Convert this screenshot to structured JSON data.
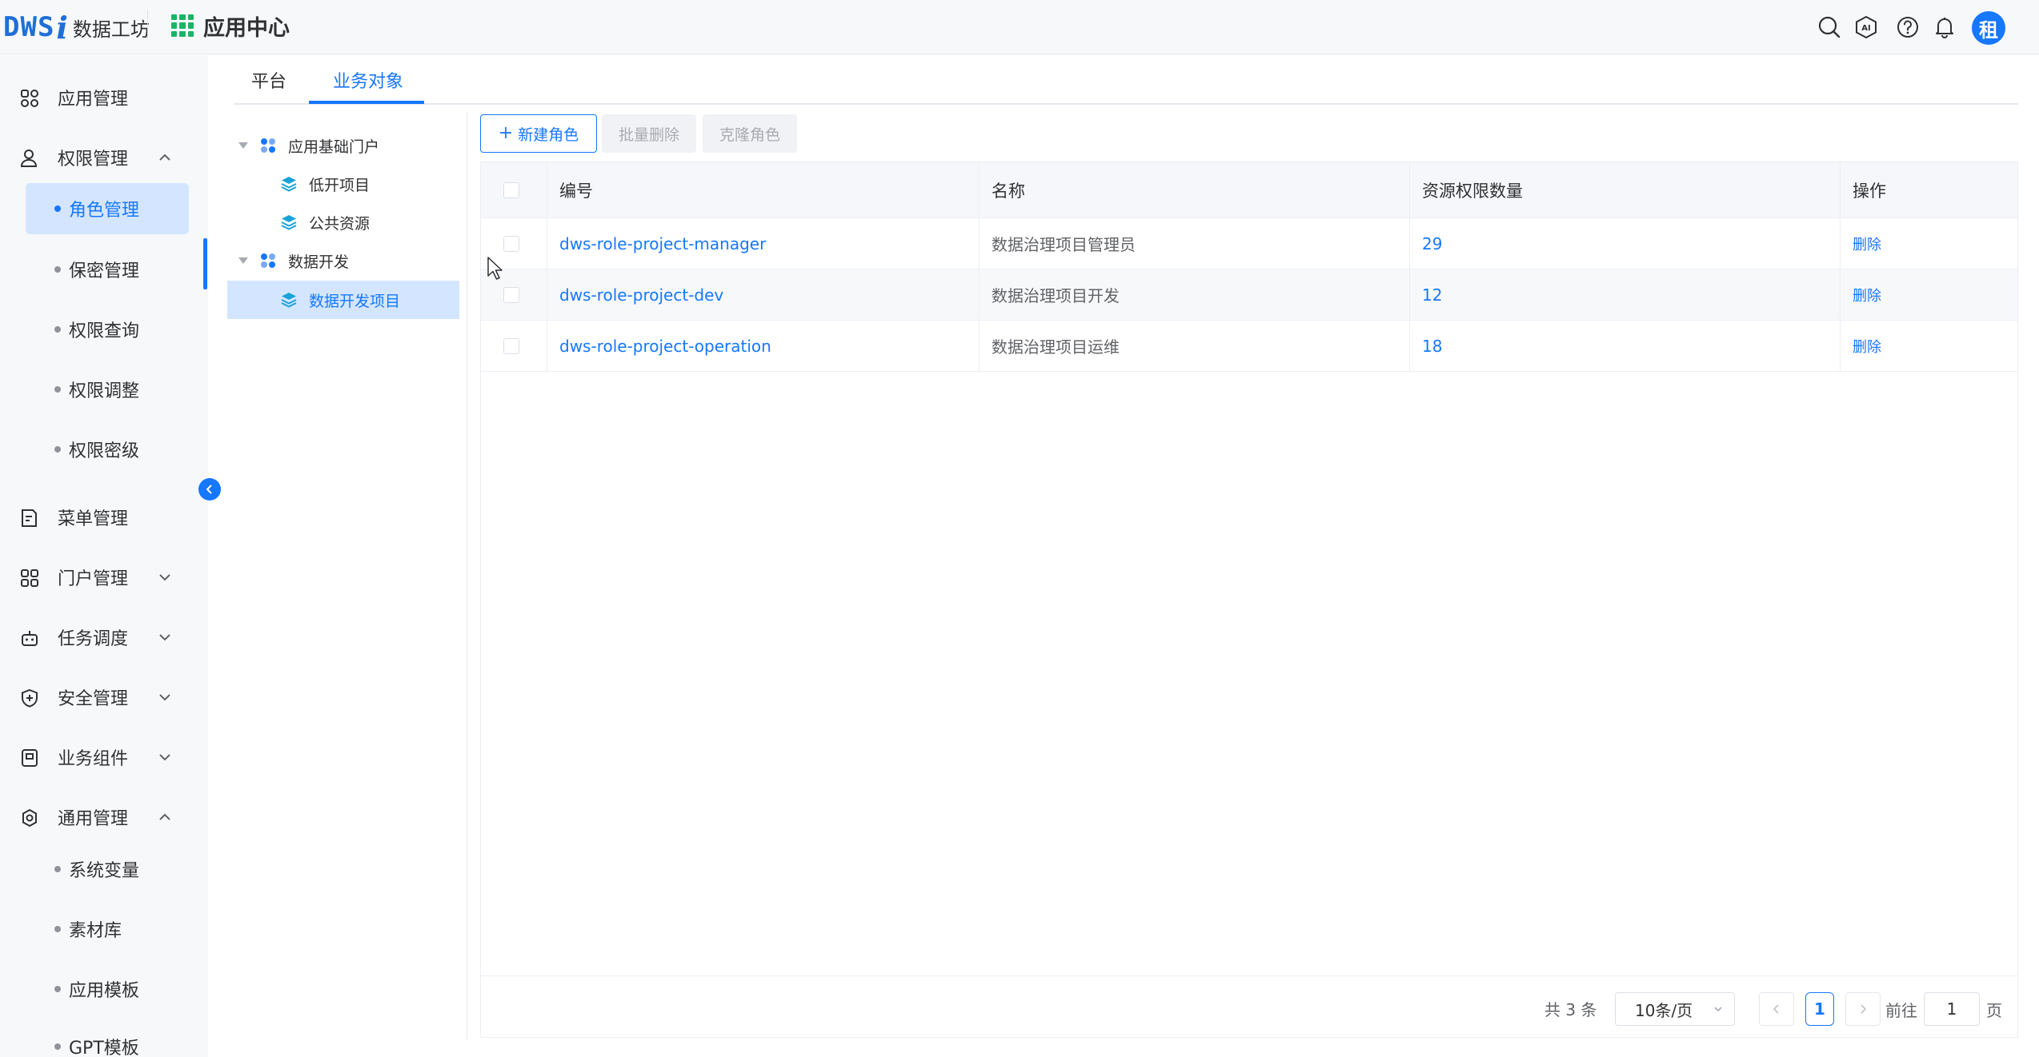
{
  "header": {
    "logo_mark": "DWS",
    "logo_i": "i",
    "logo_text": "数据工坊",
    "app_center_title": "应用中心",
    "avatar_text": "租",
    "icons": [
      "search-icon",
      "ai-icon",
      "help-icon",
      "bell-icon"
    ]
  },
  "sidebar": {
    "app_mgmt": "应用管理",
    "perm_mgmt": "权限管理",
    "perm_sub": [
      "角色管理",
      "保密管理",
      "权限查询",
      "权限调整",
      "权限密级"
    ],
    "menu_mgmt": "菜单管理",
    "portal_mgmt": "门户管理",
    "task_sched": "任务调度",
    "security_mgmt": "安全管理",
    "biz_component": "业务组件",
    "general_mgmt": "通用管理",
    "general_sub": [
      "系统变量",
      "素材库",
      "应用模板",
      "GPT模板"
    ]
  },
  "tabs": [
    "平台",
    "业务对象"
  ],
  "tree": {
    "group1": "应用基础门户",
    "group1_children": [
      "低开项目",
      "公共资源"
    ],
    "group2": "数据开发",
    "group2_children": [
      "数据开发项目"
    ]
  },
  "toolbar": {
    "new_role": "新建角色",
    "batch_delete": "批量删除",
    "clone_role": "克隆角色"
  },
  "table": {
    "columns": [
      "编号",
      "名称",
      "资源权限数量",
      "操作"
    ],
    "rows": [
      {
        "code": "dws-role-project-manager",
        "name": "数据治理项目管理员",
        "count": "29",
        "action": "删除"
      },
      {
        "code": "dws-role-project-dev",
        "name": "数据治理项目开发",
        "count": "12",
        "action": "删除"
      },
      {
        "code": "dws-role-project-operation",
        "name": "数据治理项目运维",
        "count": "18",
        "action": "删除"
      }
    ]
  },
  "pagination": {
    "total": "共 3 条",
    "page_size": "10条/页",
    "current_page": "1",
    "goto_label": "前往",
    "goto_value": "1",
    "page_unit": "页"
  },
  "colors": {
    "primary": "#1677ff",
    "grid_icon": "#18b566",
    "active_bg": "#d4e6ff"
  }
}
